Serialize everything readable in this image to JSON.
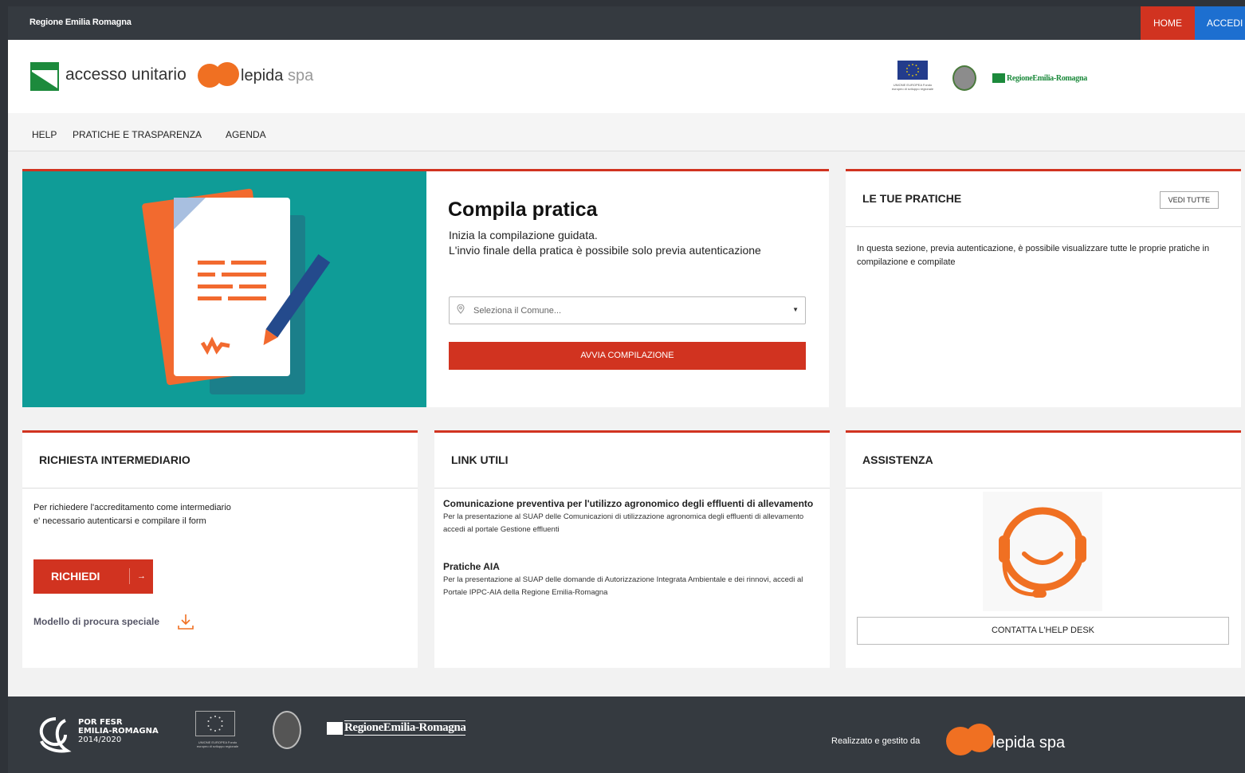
{
  "topbar": {
    "brand": "Regione Emilia Romagna",
    "home_label": "HOME",
    "accedi_label": "ACCEDI"
  },
  "header": {
    "logo_text": "accesso unitario",
    "lepida_name": "lepida",
    "lepida_spa": "spa",
    "eu_caption": "UNIONE EUROPEA Fondo europeo di sviluppo regionale",
    "rer_logo_text": "RegioneEmilia-Romagna"
  },
  "nav": {
    "items": [
      "HELP",
      "PRATICHE E TRASPARENZA",
      "AGENDA"
    ]
  },
  "hero": {
    "title": "Compila pratica",
    "subtitle1": "Inizia la compilazione guidata.",
    "subtitle2": "L'invio finale della pratica è possibile solo previa autenticazione",
    "select_placeholder": "Seleziona il Comune...",
    "start_button": "AVVIA COMPILAZIONE"
  },
  "pratiche": {
    "title": "LE TUE PRATICHE",
    "view_all": "VEDI TUTTE",
    "text": "In questa sezione, previa autenticazione, è possibile visualizzare tutte le proprie pratiche in compilazione e compilate"
  },
  "intermediario": {
    "title": "RICHIESTA INTERMEDIARIO",
    "text": "Per richiedere l'accreditamento come intermediario e' necessario autenticarsi e compilare il form",
    "button": "RICHIEDI",
    "button_arrow": "→",
    "procura": "Modello di procura speciale"
  },
  "links": {
    "title": "LINK UTILI",
    "items": [
      {
        "title": "Comunicazione preventiva per l'utilizzo agronomico degli effluenti di allevamento",
        "desc": "Per la presentazione al SUAP delle Comunicazioni di utilizzazione agronomica degli effluenti di allevamento accedi al portale Gestione effluenti"
      },
      {
        "title": "Pratiche AIA",
        "desc": "Per la presentazione al SUAP delle domande di Autorizzazione Integrata Ambientale e dei rinnovi, accedi al Portale IPPC-AIA della Regione Emilia-Romagna"
      }
    ]
  },
  "assistenza": {
    "title": "ASSISTENZA",
    "button": "CONTATTA L'HELP DESK"
  },
  "footer": {
    "por_line1": "POR FESR",
    "por_line2": "EMILIA-ROMAGNA",
    "por_line3": "2014/2020",
    "eu_caption": "UNIONE EUROPEA Fondo europeo di sviluppo regionale",
    "rer_logo_text": "RegioneEmilia-Romagna",
    "made_by": "Realizzato e gestito da",
    "lepida": "lepida spa"
  },
  "colors": {
    "accent_red": "#d13320",
    "accedi_blue": "#1d6fd0",
    "dark_bar": "#353a40",
    "hero_teal": "#0f9c97",
    "lepida_orange": "#f07022",
    "rer_green": "#1c8a3c"
  }
}
